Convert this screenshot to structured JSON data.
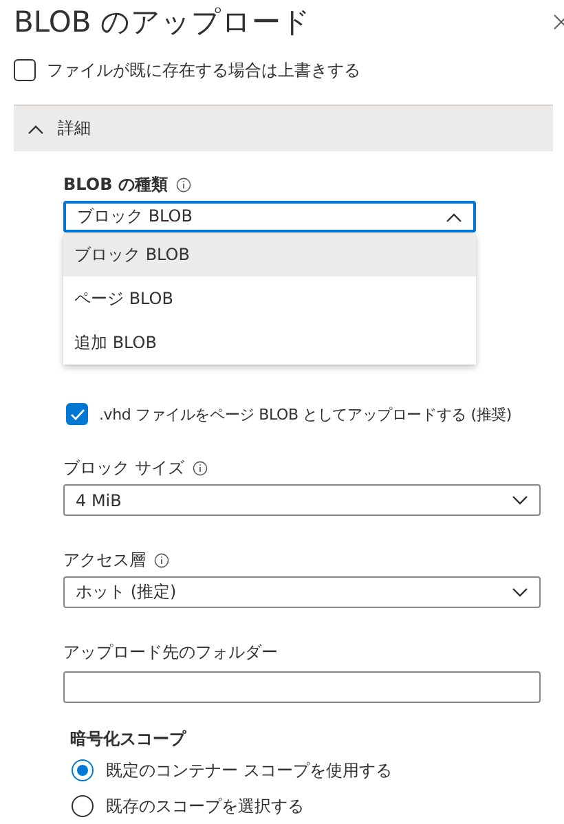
{
  "title": "BLOB のアップロード",
  "overwrite": {
    "label": "ファイルが既に存在する場合は上書きする",
    "checked": false
  },
  "advanced": {
    "label": "詳細",
    "expanded": true
  },
  "blob_type": {
    "label": "BLOB の種類",
    "value": "ブロック BLOB",
    "open": true,
    "options": [
      {
        "label": "ブロック BLOB",
        "selected": true
      },
      {
        "label": "ページ BLOB",
        "selected": false
      },
      {
        "label": "追加 BLOB",
        "selected": false
      }
    ]
  },
  "vhd": {
    "label": ".vhd ファイルをページ BLOB としてアップロードする (推奨)",
    "checked": true
  },
  "block_size": {
    "label": "ブロック サイズ",
    "value": "4 MiB"
  },
  "access_tier": {
    "label": "アクセス層",
    "value": "ホット (推定)"
  },
  "folder": {
    "label": "アップロード先のフォルダー"
  },
  "encryption": {
    "label": "暗号化スコープ",
    "options": [
      {
        "label": "既定のコンテナー スコープを使用する",
        "selected": true
      },
      {
        "label": "既存のスコープを選択する",
        "selected": false
      }
    ]
  }
}
